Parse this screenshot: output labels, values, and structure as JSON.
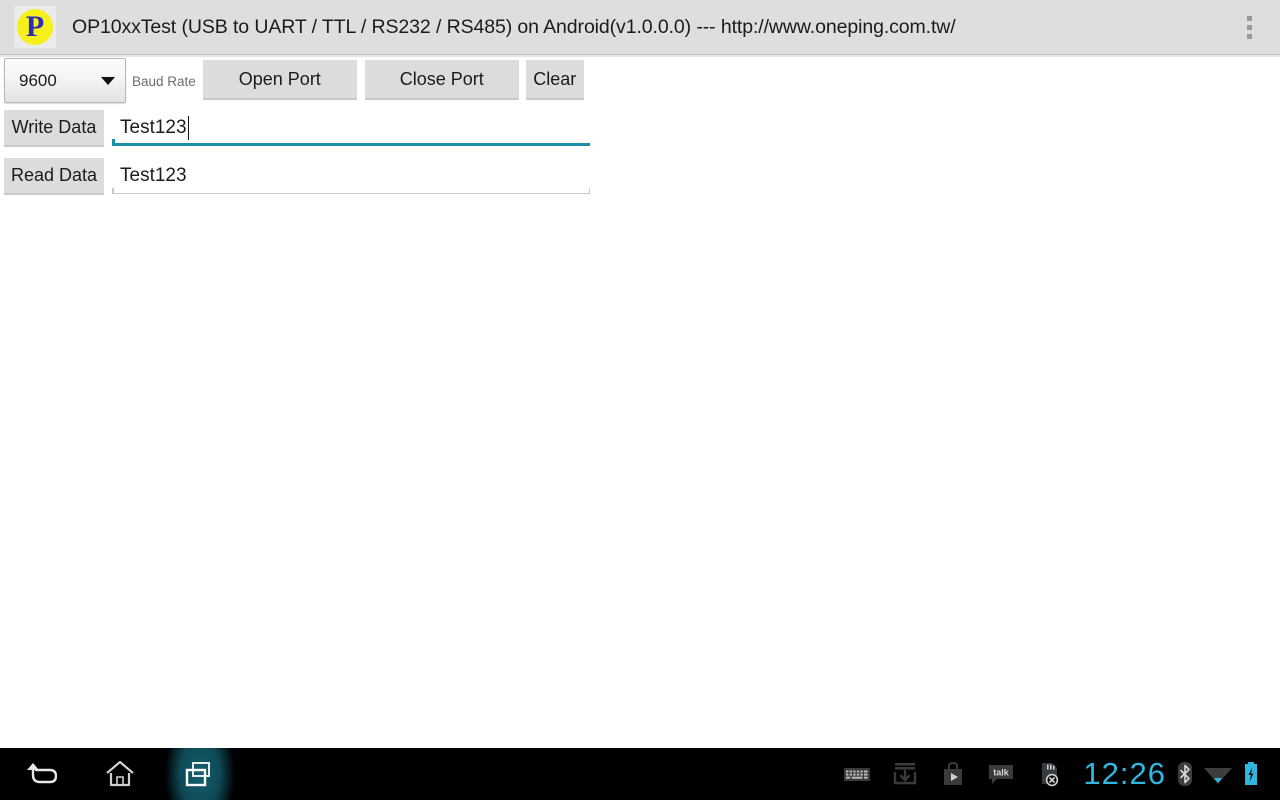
{
  "titlebar": {
    "app_icon_name": "oneping-p-logo-icon",
    "app_icon_letter": "P",
    "title": "OP10xxTest (USB to UART / TTL / RS232 / RS485) on Android(v1.0.0.0) --- http://www.oneping.com.tw/",
    "overflow_menu_name": "overflow-menu-icon"
  },
  "toolbar": {
    "baud_rate_value": "9600",
    "baud_rate_label": "Baud Rate",
    "baud_rate_options": [
      "9600"
    ],
    "open_port_label": "Open Port",
    "close_port_label": "Close Port",
    "clear_label": "Clear"
  },
  "write_row": {
    "button_label": "Write Data",
    "value": "Test123",
    "placeholder": "",
    "focused": true,
    "underline_color": "#1a8fa6"
  },
  "read_row": {
    "button_label": "Read Data",
    "value": "Test123",
    "placeholder": "",
    "focused": false,
    "underline_color": "#c9c9c9"
  },
  "navbar": {
    "back_icon": "back-arrow-icon",
    "home_icon": "home-icon",
    "recents_icon": "recent-apps-icon",
    "status_icons": [
      "keyboard-icon",
      "download-icon",
      "play-store-icon",
      "talk-icon",
      "sd-card-removed-icon"
    ],
    "talk_label": "talk",
    "clock": "12:26",
    "bluetooth_icon": "bluetooth-icon",
    "wifi_icon": "wifi-icon",
    "battery_icon": "battery-charging-icon",
    "clock_color": "#2fb7e0",
    "battery_color": "#2fb7e0"
  },
  "colors": {
    "titlebar_bg": "#dedede",
    "button_bg": "#dcdcdc",
    "content_bg": "#ffffff",
    "navbar_bg": "#000000",
    "accent_teal": "#1a8fa6"
  }
}
